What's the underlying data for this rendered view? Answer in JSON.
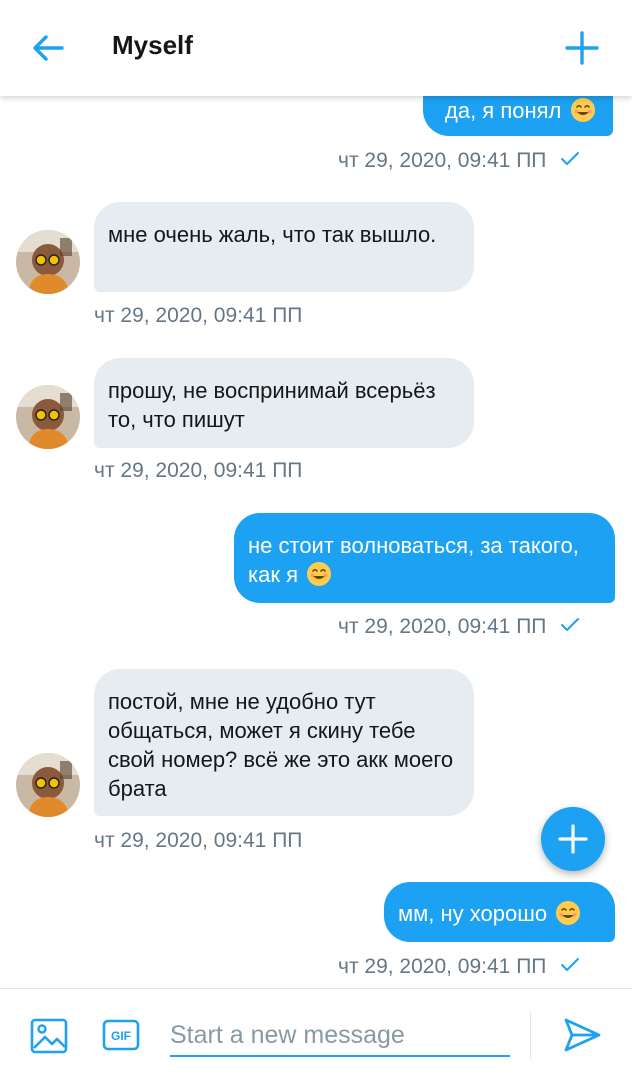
{
  "header": {
    "title": "Myself",
    "back_icon": "arrow-left-icon",
    "add_icon": "plus-icon"
  },
  "colors": {
    "accent": "#1da1f2",
    "incoming_bubble": "#e6ecf0",
    "timestamp": "#657786"
  },
  "messages": [
    {
      "direction": "out",
      "text": "да, я понял",
      "emoji": "smiling-face-icon",
      "timestamp": "чт 29, 2020, 09:41 ПП",
      "read": true
    },
    {
      "direction": "in",
      "text": "мне очень жаль, что так вышло.",
      "timestamp": "чт 29, 2020, 09:41 ПП"
    },
    {
      "direction": "in",
      "text": "прошу, не воспринимай всерьёз то, что пишут",
      "timestamp": "чт 29, 2020, 09:41 ПП"
    },
    {
      "direction": "out",
      "text": "не стоит волноваться, за такого, как я",
      "emoji": "smiling-face-icon",
      "timestamp": "чт 29, 2020, 09:41 ПП",
      "read": true
    },
    {
      "direction": "in",
      "text": "постой, мне не удобно тут общаться, может я скину тебе свой номер? всё же это акк моего брата",
      "timestamp": "чт 29, 2020, 09:41 ПП"
    },
    {
      "direction": "out",
      "text": "мм, ну хорошо",
      "emoji": "smiling-face-icon",
      "timestamp": "чт 29, 2020, 09:41 ПП",
      "read": true
    }
  ],
  "composer": {
    "placeholder": "Start a new message",
    "gif_label": "GIF",
    "image_icon": "image-icon",
    "send_icon": "send-icon"
  }
}
